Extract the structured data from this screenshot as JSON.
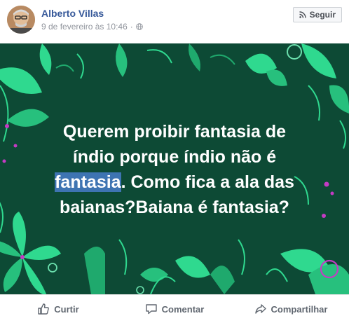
{
  "post": {
    "author": "Alberto Villas",
    "timestamp": "9 de fevereiro às 10:46",
    "separator": "·",
    "privacy_icon": "globe-icon",
    "follow_label": "Seguir",
    "follow_icon": "rss-icon"
  },
  "image_text": {
    "line1": "Querem proibir fantasia de",
    "line2": "índio porque índio não é",
    "line3_highlight": "fantasia",
    "line3_rest": ". Como fica a ala das",
    "line4": "baianas?Baiana é fantasia?"
  },
  "colors": {
    "background": "#0d4a35",
    "leaf": "#2fd98f",
    "accent": "#c43bc4",
    "highlight": "#3e74b2",
    "author_link": "#365899"
  },
  "actions": [
    {
      "label": "Curtir",
      "icon": "thumbs-up-icon"
    },
    {
      "label": "Comentar",
      "icon": "comment-icon"
    },
    {
      "label": "Compartilhar",
      "icon": "share-icon"
    }
  ]
}
